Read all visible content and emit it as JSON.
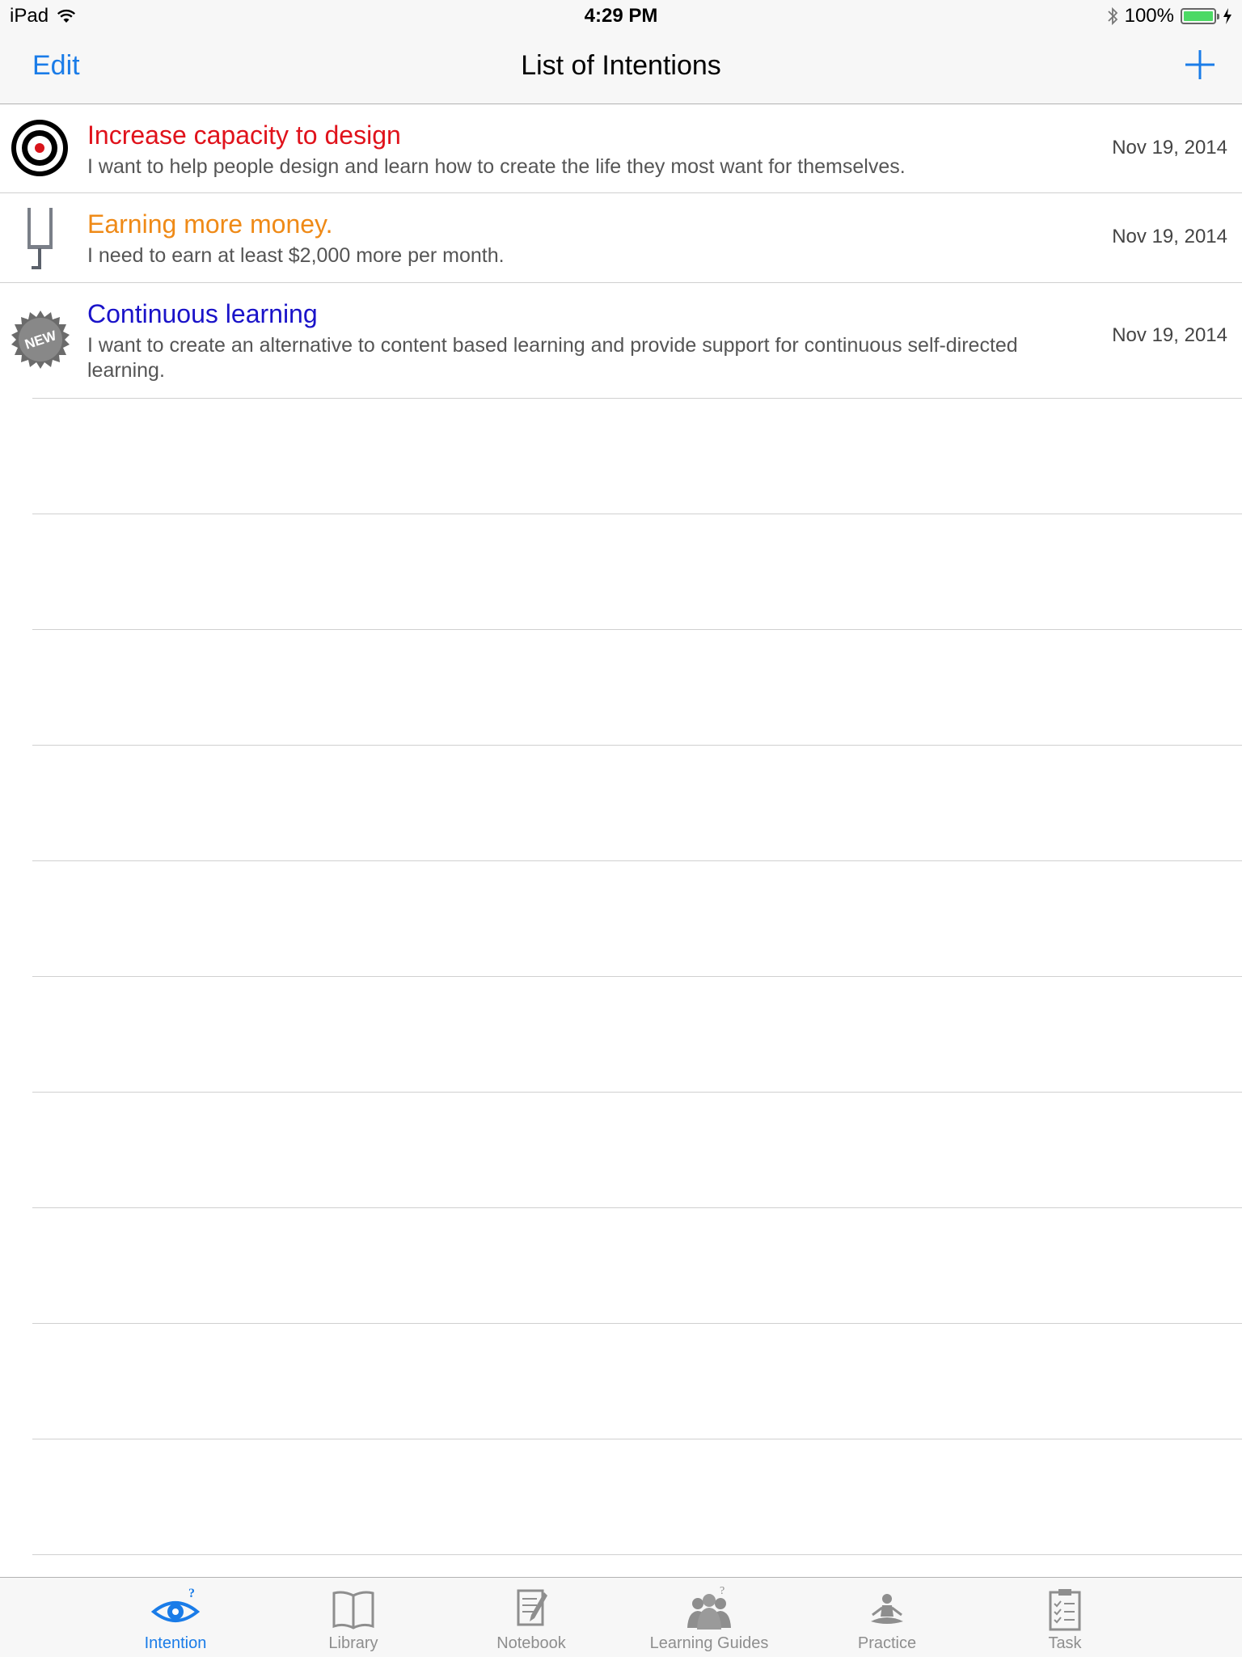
{
  "status_bar": {
    "device": "iPad",
    "time": "4:29 PM",
    "battery": "100%"
  },
  "nav": {
    "edit_label": "Edit",
    "title": "List of Intentions",
    "add_icon": "plus-icon"
  },
  "intentions": [
    {
      "title": "Increase capacity to design",
      "title_color": "#e0121b",
      "description": "I want to help people design and learn how to create the life they most want for themselves.",
      "date": "Nov 19, 2014",
      "icon": "target-icon"
    },
    {
      "title": "Earning more money.",
      "title_color": "#ef8a17",
      "description": "I need to earn at least $2,000 more per month.",
      "date": "Nov 19, 2014",
      "icon": "goalpost-icon"
    },
    {
      "title": "Continuous learning",
      "title_color": "#1a13c9",
      "description": "I want to create an alternative to content based learning and provide support for continuous self-directed learning.",
      "date": "Nov 19, 2014",
      "icon": "new-badge-icon",
      "badge_text": "NEW"
    }
  ],
  "tabs": [
    {
      "label": "Intention",
      "icon": "eye-icon",
      "active": true
    },
    {
      "label": "Library",
      "icon": "book-icon",
      "active": false
    },
    {
      "label": "Notebook",
      "icon": "notebook-icon",
      "active": false
    },
    {
      "label": "Learning Guides",
      "icon": "people-icon",
      "active": false
    },
    {
      "label": "Practice",
      "icon": "meditation-icon",
      "active": false
    },
    {
      "label": "Task",
      "icon": "clipboard-icon",
      "active": false
    }
  ],
  "colors": {
    "accent": "#1a7ce8",
    "inactive_tab": "#8e8e8e"
  }
}
